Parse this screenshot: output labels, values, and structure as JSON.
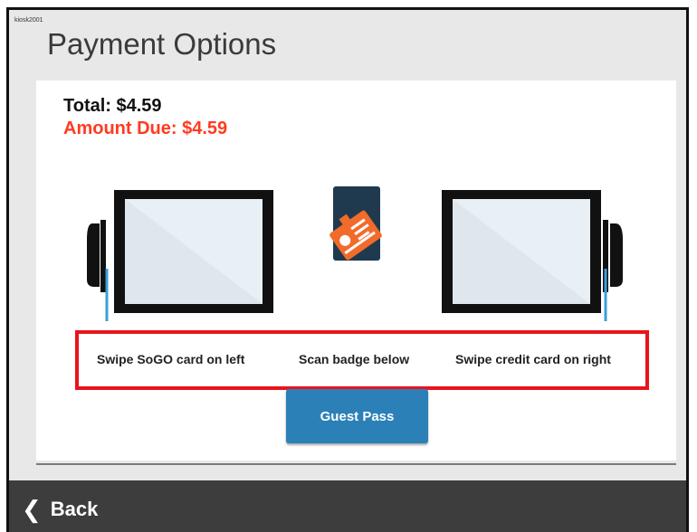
{
  "kiosk_id": "kiosk2001",
  "page_title": "Payment Options",
  "summary": {
    "total_label": "Total: $4.59",
    "amount_due_label": "Amount Due: $4.59"
  },
  "instructions": {
    "left": "Swipe SoGO card on left",
    "center": "Scan badge below",
    "right": "Swipe credit card on right"
  },
  "guest_button_label": "Guest Pass",
  "footer": {
    "back_label": "Back",
    "back_icon": "chevron-left-icon"
  },
  "colors": {
    "amount_due": "#ff3b1f",
    "highlight_border": "#e8141b",
    "button": "#2b80b7",
    "footer": "#3d3d3d",
    "badge_orange": "#f26b2a",
    "badge_dark": "#1f3a4f"
  }
}
